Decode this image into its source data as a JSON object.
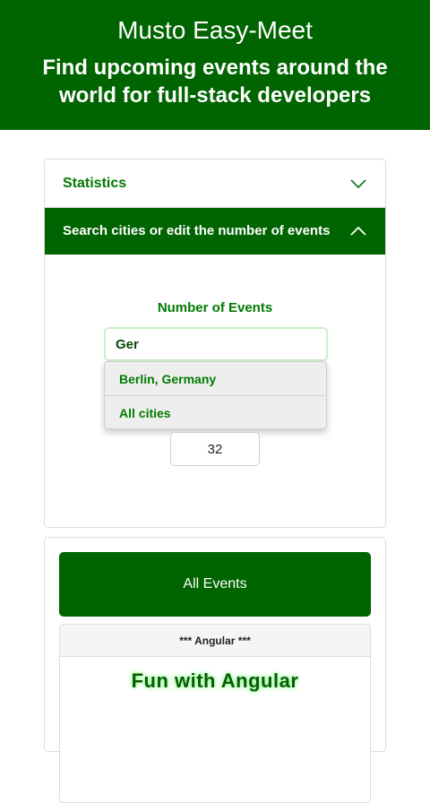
{
  "header": {
    "title": "Musto Easy-Meet",
    "subtitle": "Find upcoming events around the world for full-stack developers"
  },
  "accordion": {
    "statistics_label": "Statistics",
    "search_label": "Search cities or edit the number of events",
    "statistics_icon": "chevron-down-icon",
    "search_icon": "chevron-up-icon"
  },
  "search": {
    "number_of_events_label": "Number of Events",
    "city_value": "Ger",
    "suggestions": [
      "Berlin, Germany",
      "All cities"
    ],
    "number_value": "32"
  },
  "events": {
    "all_events_label": "All Events",
    "cards": [
      {
        "header": "*** Angular ***",
        "name": "Fun with Angular"
      }
    ]
  },
  "colors": {
    "primary": "#006400",
    "text_green": "#007a00"
  }
}
